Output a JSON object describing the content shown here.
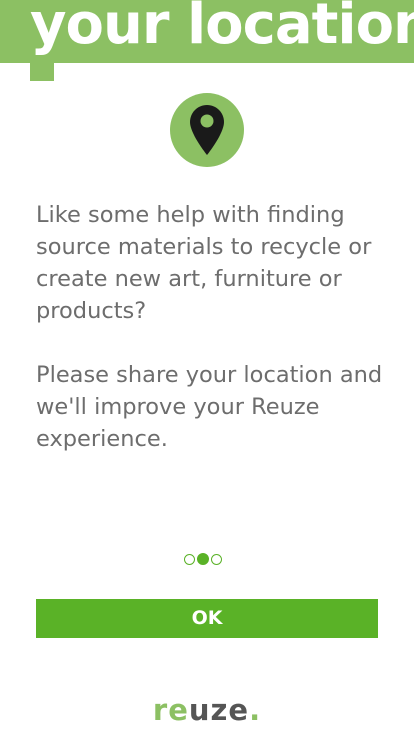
{
  "header": {
    "title": "your location"
  },
  "icon": {
    "name": "map-pin-icon",
    "circle_color": "#8cc063",
    "glyph_color": "#1a1a1a"
  },
  "body": {
    "paragraph_1": "Like some help with finding source materials to recycle or create new art, furniture or products?",
    "paragraph_2": "Please share your location and we'll improve your Reuze experience."
  },
  "pager": {
    "total": 3,
    "active_index": 1
  },
  "actions": {
    "ok_label": "OK"
  },
  "brand": {
    "part_1": "re",
    "part_2": "uze",
    "part_3": "."
  },
  "colors": {
    "accent_light": "#8cc063",
    "accent_dark": "#5ab227",
    "text": "#6d6d6d"
  }
}
